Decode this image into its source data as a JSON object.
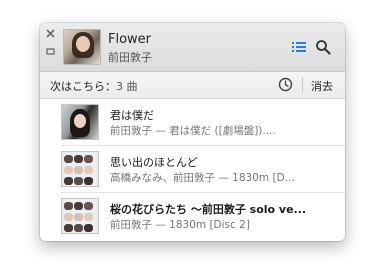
{
  "now_playing": {
    "title": "Flower",
    "artist": "前田敦子"
  },
  "header_icons": {
    "close": "close-icon",
    "mini": "minimize-icon",
    "list": "list-icon",
    "search": "search-icon"
  },
  "up_next": {
    "label": "次はこちら：",
    "count": "3 曲",
    "history_icon": "clock-icon",
    "clear_label": "消去"
  },
  "queue": [
    {
      "title": "君は僕だ",
      "subtitle": "前田敦子 — 君は僕だ ([劇場盤])...."
    },
    {
      "title": "思い出のほとんど",
      "subtitle": "高橋みなみ、前田敦子 — 1830m [D..."
    },
    {
      "title": "桜の花びらたち 〜前田敦子 solo ve...",
      "subtitle": "前田敦子 — 1830m [Disc 2]"
    }
  ],
  "colors": {
    "accent": "#2a7be0",
    "header_bg": "#e3e3e3"
  }
}
